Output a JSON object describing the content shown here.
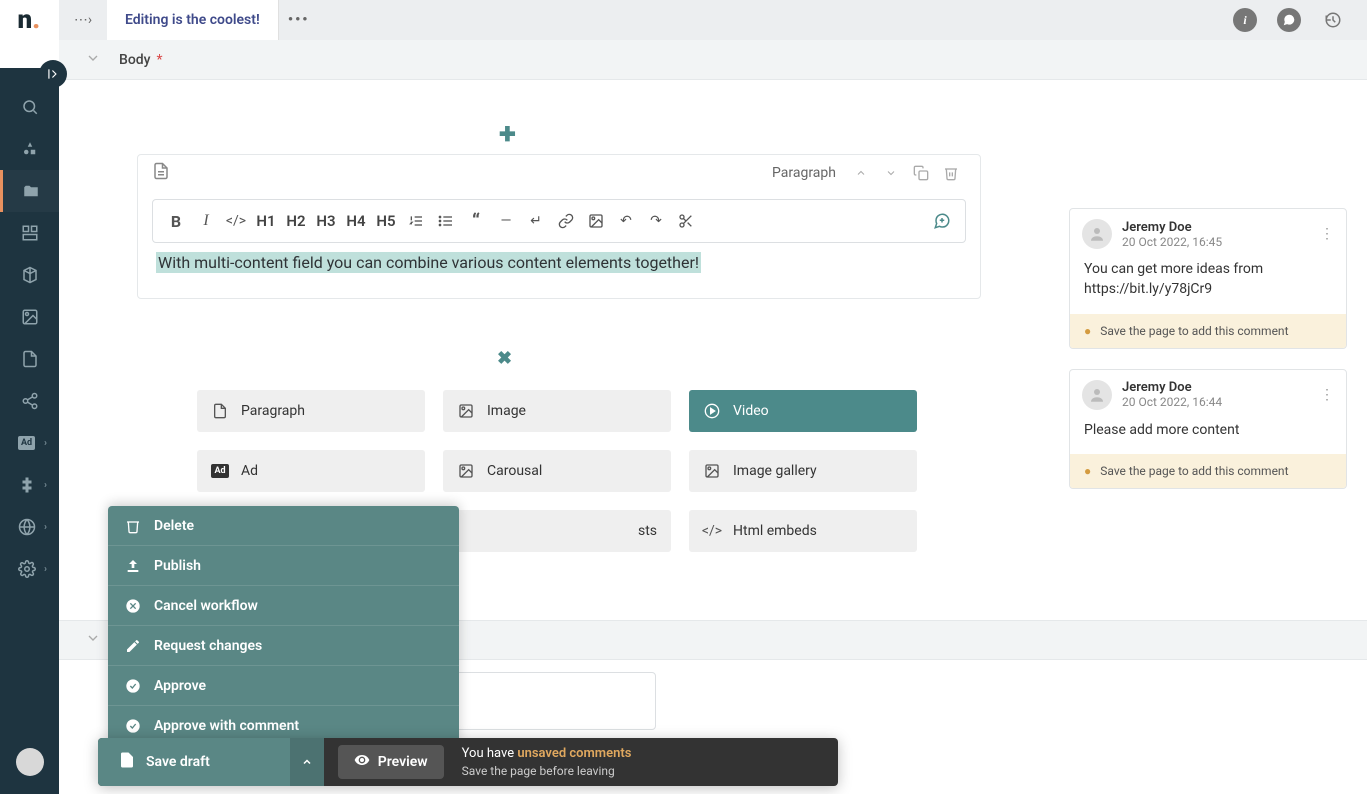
{
  "header": {
    "title": "Editing is the coolest!"
  },
  "subheader": {
    "label": "Body",
    "required": "*"
  },
  "block": {
    "type_label": "Paragraph",
    "content_text": "With multi-content field you can combine various content elements together!",
    "toolbar": {
      "h1": "H1",
      "h2": "H2",
      "h3": "H3",
      "h4": "H4",
      "h5": "H5"
    }
  },
  "type_buttons": [
    {
      "label": "Paragraph"
    },
    {
      "label": "Image"
    },
    {
      "label": "Video"
    },
    {
      "label": "Ad"
    },
    {
      "label": "Carousal"
    },
    {
      "label": "Image gallery"
    },
    {
      "label": ""
    },
    {
      "label": "sts"
    },
    {
      "label": "Html embeds"
    }
  ],
  "action_menu": [
    {
      "label": "Delete"
    },
    {
      "label": "Publish"
    },
    {
      "label": "Cancel workflow"
    },
    {
      "label": "Request changes"
    },
    {
      "label": "Approve"
    },
    {
      "label": "Approve with comment"
    }
  ],
  "bottom": {
    "save_label": "Save draft",
    "preview_label": "Preview",
    "unsaved_prefix": "You have ",
    "unsaved_highlight": "unsaved comments",
    "unsaved_sub": "Save the page before leaving"
  },
  "comments": [
    {
      "user": "Jeremy Doe",
      "date": "20 Oct 2022, 16:45",
      "body": "You can get more ideas from https://bit.ly/y78jCr9",
      "warn": "Save the page to add this comment"
    },
    {
      "user": "Jeremy Doe",
      "date": "20 Oct 2022, 16:44",
      "body": "Please add more content",
      "warn": "Save the page to add this comment"
    }
  ]
}
